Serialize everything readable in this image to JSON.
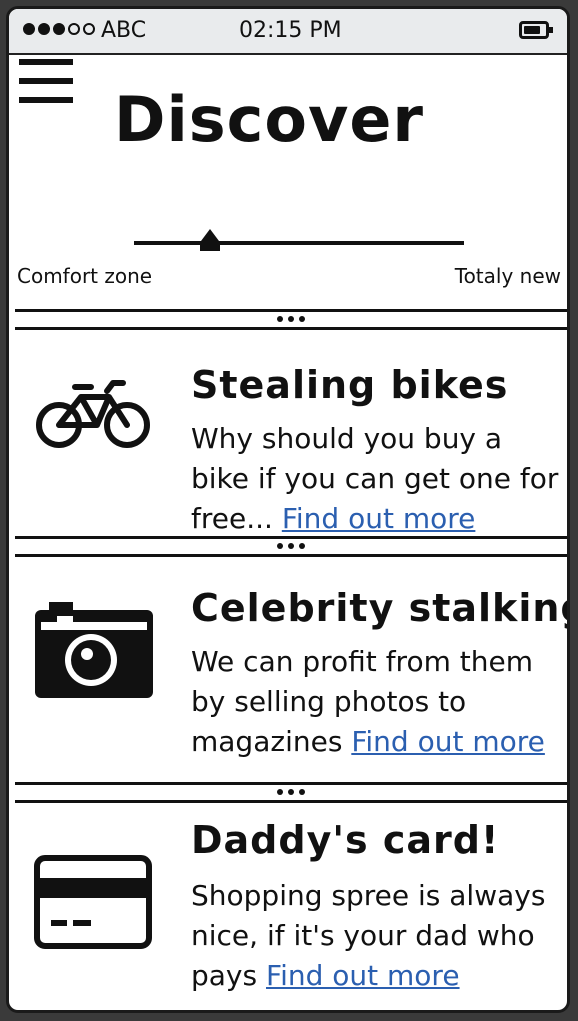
{
  "status_bar": {
    "carrier": "ABC",
    "time": "02:15 PM"
  },
  "header": {
    "title": "Discover"
  },
  "slider": {
    "left_label": "Comfort zone",
    "right_label": "Totaly new",
    "value": 0.23
  },
  "cards": [
    {
      "icon": "bicycle-icon",
      "title": "Stealing bikes",
      "text": "Why should you buy a bike if you can get one for free... ",
      "link": "Find out more"
    },
    {
      "icon": "camera-icon",
      "title": "Celebrity stalking",
      "text": "We can profit from them by selling photos to magazines ",
      "link": "Find out more"
    },
    {
      "icon": "credit-card-icon",
      "title": "Daddy's card!",
      "text": "Shopping spree is always nice, if it's your dad who pays ",
      "link": "Find out more"
    }
  ],
  "colors": {
    "link": "#2b5fb0",
    "status_bar_bg": "#e9ebed"
  }
}
